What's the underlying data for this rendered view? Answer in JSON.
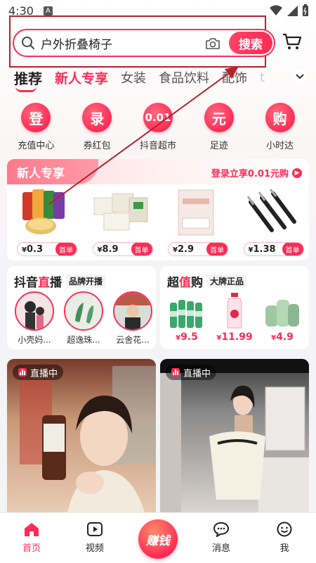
{
  "status_bar": {
    "time": "4:30",
    "notif_icon_letter": "A"
  },
  "search": {
    "query": "户外折叠椅子",
    "button_label": "搜索"
  },
  "tabs": [
    "推荐",
    "新人专享",
    "女装",
    "食品饮料",
    "配饰",
    "t"
  ],
  "quick_links": [
    {
      "glyph": "登",
      "label": "充值中心"
    },
    {
      "glyph": "录",
      "label": "券红包"
    },
    {
      "glyph": "0.01",
      "label": "抖音超市"
    },
    {
      "glyph": "元",
      "label": "足迹"
    },
    {
      "glyph": "购",
      "label": "小时达"
    }
  ],
  "new_user": {
    "title": "新人专享",
    "link_text": "登录立享0.01元购",
    "products": [
      {
        "currency": "¥",
        "price": "0.3",
        "badge": "首单"
      },
      {
        "currency": "¥",
        "price": "8.9",
        "badge": "首单"
      },
      {
        "currency": "¥",
        "price": "2.9",
        "badge": "首单"
      },
      {
        "currency": "¥",
        "price": "1.38",
        "badge": "首单"
      }
    ]
  },
  "live_card": {
    "title_pre": "抖音",
    "title_hl": "直",
    "title_post": "播",
    "subtitle": "品牌开播",
    "streamers": [
      {
        "name": "小壳妈..."
      },
      {
        "name": "超逸珠..."
      },
      {
        "name": "云舍花..."
      }
    ]
  },
  "deal_card": {
    "title_pre": "超",
    "title_hl": "值",
    "title_post": "购",
    "subtitle": "大牌正品",
    "deals": [
      {
        "currency": "¥",
        "price": "9.5"
      },
      {
        "currency": "¥",
        "price": "11.99"
      },
      {
        "currency": "¥",
        "price": "4.9"
      }
    ]
  },
  "videos": [
    {
      "badge": "直播中"
    },
    {
      "badge": "直播中"
    }
  ],
  "bottom_nav": {
    "home": "首页",
    "video": "视频",
    "earn": "赚钱",
    "messages": "消息",
    "me": "我"
  },
  "colors": {
    "accent": "#fe2c55",
    "annotation": "#b8222c"
  }
}
